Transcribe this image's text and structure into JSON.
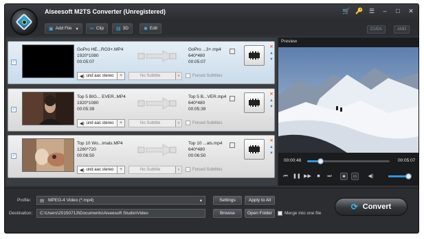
{
  "app": {
    "title": "Aiseesoft M2TS Converter (Unregistered)"
  },
  "window_controls": [
    "🛒",
    "🔑",
    "☰",
    "–",
    "□",
    "✕"
  ],
  "toolbar": {
    "add_file": "Add File",
    "clip": "Clip",
    "three_d": "3D",
    "edit": "Edit",
    "cuda": "CUDA",
    "amd": "AMD"
  },
  "files": [
    {
      "source_name": "GoPro HE...RO3+.MP4",
      "source_res": "1920*1080",
      "source_dur": "00:05:07",
      "dest_name": "GoPro ...3+.mp4",
      "dest_res": "640*480",
      "dest_dur": "00:05:07",
      "audio": "und aac stereo",
      "subtitle": "No Subtitle",
      "forced": "Forced Subtitles"
    },
    {
      "source_name": "Top 5 BIG... EVER..MP4",
      "source_res": "1920*1080",
      "source_dur": "00:05:39",
      "dest_name": "Top 5 B...VER.mp4",
      "dest_res": "640*480",
      "dest_dur": "00:05:39",
      "audio": "und aac stereo",
      "subtitle": "No Subtitle",
      "forced": "Forced Subtitles"
    },
    {
      "source_name": "Top 10 Wo...imals.MP4",
      "source_res": "1280*720",
      "source_dur": "00:06:50",
      "dest_name": "Top 10 ...als.mp4",
      "dest_res": "640*480",
      "dest_dur": "00:06:50",
      "audio": "und aac stereo",
      "subtitle": "No Subtitle",
      "forced": "Forced Subtitles"
    }
  ],
  "preview": {
    "label": "Preview",
    "current_time": "00:00:48",
    "total_time": "00:05:07",
    "progress": 0.156,
    "volume": 0.85
  },
  "bottom": {
    "profile_label": "Profile:",
    "profile_value": "MPEG-4 Video (*.mp4)",
    "settings": "Settings",
    "apply_all": "Apply to All",
    "destination_label": "Destination:",
    "destination_value": "C:\\Users\\20150713\\Documents\\Aiseesoft Studio\\Video",
    "browse": "Browse",
    "open_folder": "Open Folder",
    "merge": "Merge into one file",
    "convert": "Convert"
  },
  "colors": {
    "accent": "#2f96d9",
    "window_bg": "#2f3236",
    "remove_icon": "#e4592a"
  },
  "chart_data": null
}
